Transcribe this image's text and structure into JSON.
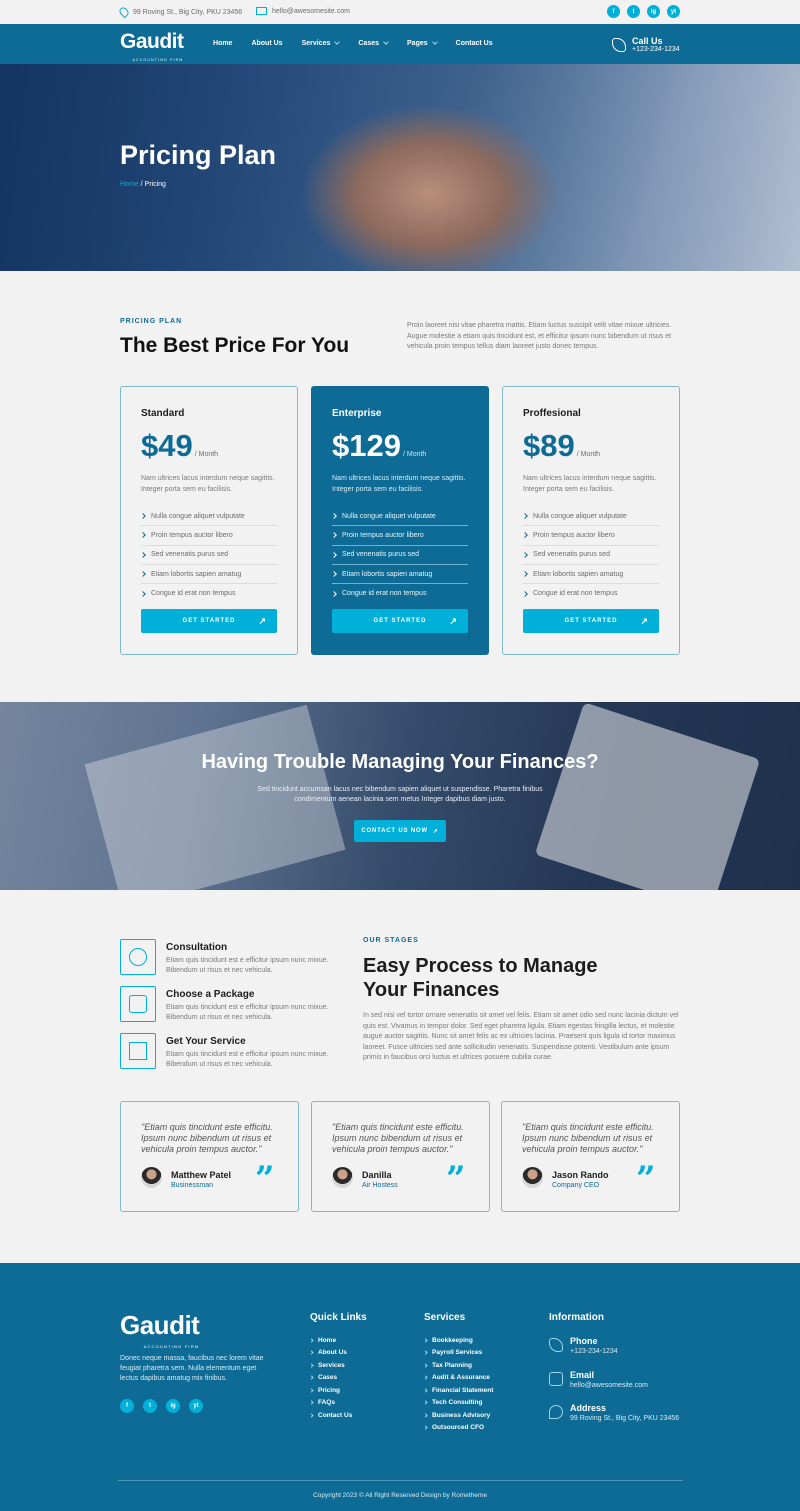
{
  "topbar": {
    "address": "99 Roving St., Big City, PKU 23456",
    "email": "hello@awesomesite.com",
    "socials": [
      "f",
      "t",
      "ig",
      "yt"
    ]
  },
  "nav": {
    "logo": "Gaudit",
    "logo_tag": "ACCOUNTING FIRM",
    "items": [
      {
        "label": "Home",
        "dropdown": false
      },
      {
        "label": "About Us",
        "dropdown": false
      },
      {
        "label": "Services",
        "dropdown": true
      },
      {
        "label": "Cases",
        "dropdown": true
      },
      {
        "label": "Pages",
        "dropdown": true
      },
      {
        "label": "Contact Us",
        "dropdown": false
      }
    ],
    "call_label": "Call Us",
    "call_number": "+123-234-1234"
  },
  "hero": {
    "title": "Pricing Plan",
    "breadcrumb_home": "Home",
    "breadcrumb_current": " / Pricing"
  },
  "pricing": {
    "label": "PRICING PLAN",
    "title": "The Best Price For You",
    "description": "Proin laoreet nisi vitae pharetra mattis. Etiam luctus suscipit velit vitae mixue ultricies. Augue molestie a etiam quis tincidunt est, et efficitur ipsum nunc bibendum ut risus et vehicula proin tempus tellus diam laoreet justo donec tempus.",
    "plans": [
      {
        "name": "Standard",
        "price": "$49",
        "per": "/ Month",
        "desc": "Nam ultrices lacus interdum neque sagittis. Integer porta sem eu facilisis.",
        "features": [
          "Nulla congue aliquet vulputate",
          "Proin tempus auctor libero",
          "Sed venenatis purus sed",
          "Etiam lobortis sapien amatug",
          "Congue id erat non tempus"
        ],
        "button": "GET STARTED"
      },
      {
        "name": "Enterprise",
        "price": "$129",
        "per": "/ Month",
        "desc": "Nam ultrices lacus interdum neque sagittis. Integer porta sem eu facilisis.",
        "features": [
          "Nulla congue aliquet vulputate",
          "Proin tempus auctor libero",
          "Sed venenatis purus sed",
          "Etiam lobortis sapien amatug",
          "Congue id erat non tempus"
        ],
        "button": "GET STARTED"
      },
      {
        "name": "Proffesional",
        "price": "$89",
        "per": "/ Month",
        "desc": "Nam ultrices lacus interdum neque sagittis. Integer porta sem eu facilisis.",
        "features": [
          "Nulla congue aliquet vulputate",
          "Proin tempus auctor libero",
          "Sed venenatis purus sed",
          "Etiam lobortis sapien amatug",
          "Congue id erat non tempus"
        ],
        "button": "GET STARTED"
      }
    ]
  },
  "cta": {
    "title": "Having Trouble Managing Your Finances?",
    "text": "Sed tincidunt accumsan lacus nec bibendum sapien aliquet ut suspendisse. Pharetra finibus condimentum aenean lacinia sem metus Integer dapibus diam justo.",
    "button": "CONTACT US NOW"
  },
  "stages": {
    "steps": [
      {
        "title": "Consultation",
        "text": "Etiam quis tincidunt est e efficitur ipsum nunc mixue. Bibendum ut risus et nec vehicula."
      },
      {
        "title": "Choose a Package",
        "text": "Etiam quis tincidunt est e efficitur ipsum nunc mixue. Bibendum ut risus et nec vehicula."
      },
      {
        "title": "Get Your Service",
        "text": "Etiam quis tincidunt est e efficitur ipsum nunc mixue. Bibendum ut risus et nec vehicula."
      }
    ],
    "label": "OUR STAGES",
    "title": "Easy Process to Manage Your Finances",
    "description": "In sed nisi vel tortor ornare venenatis sit amet vel felis. Etiam sit amet odio sed nunc lacinia dictum vel quis est. Vivamus in tempor dolor. Sed eget pharetra ligula. Etiam egestas fringilla lectus, et molestie augue auctor sagittis. Nunc sit amet felis ac ex ultricies lacinia. Praesent quis ligula id tortor maximus laoreet. Fusce ultricies sed ante sollicitudin venenatis. Suspendisse potenti. Vestibulum ante ipsum primis in faucibus orci luctus et ultrices posuere cubilia curae."
  },
  "testimonials": [
    {
      "quote": "\"Etiam quis tincidunt este efficitu. Ipsum nunc bibendum ut risus et vehicula proin tempus auctor.\"",
      "name": "Matthew Patel",
      "role": "Businessman"
    },
    {
      "quote": "\"Etiam quis tincidunt este efficitu. Ipsum nunc bibendum ut risus et vehicula proin tempus auctor.\"",
      "name": "Danilla",
      "role": "Air Hostess"
    },
    {
      "quote": "\"Etiam quis tincidunt este efficitu. Ipsum nunc bibendum ut risus et vehicula proin tempus auctor.\"",
      "name": "Jason Rando",
      "role": "Company CEO"
    }
  ],
  "footer": {
    "logo": "Gaudit",
    "logo_tag": "ACCOUNTING FIRM",
    "description": "Donec neque massa, faucibus nec lorem vitae feugiat pharetra sem. Nulla elementum eget lectus dapibus amatug mix finibus.",
    "quick_links_title": "Quick Links",
    "quick_links": [
      "Home",
      "About Us",
      "Services",
      "Cases",
      "Pricing",
      "FAQs",
      "Contact Us"
    ],
    "services_title": "Services",
    "services": [
      "Bookkeeping",
      "Payroll Services",
      "Tax Planning",
      "Audit & Assurance",
      "Financial Statement",
      "Tech Consulting",
      "Business Advisory",
      "Outsourced CFO"
    ],
    "info_title": "Information",
    "info": [
      {
        "k": "Phone",
        "v": "+123-234-1234"
      },
      {
        "k": "Email",
        "v": "hello@awesomesite.com"
      },
      {
        "k": "Address",
        "v": "99 Roving St., Big City, PKU 23456"
      }
    ],
    "copyright": "Copyright 2023 © All Right Reserved Design by Rometheme"
  },
  "colors": {
    "primary": "#0d6b96",
    "accent": "#00b0d8",
    "background": "#f2f2f2"
  }
}
